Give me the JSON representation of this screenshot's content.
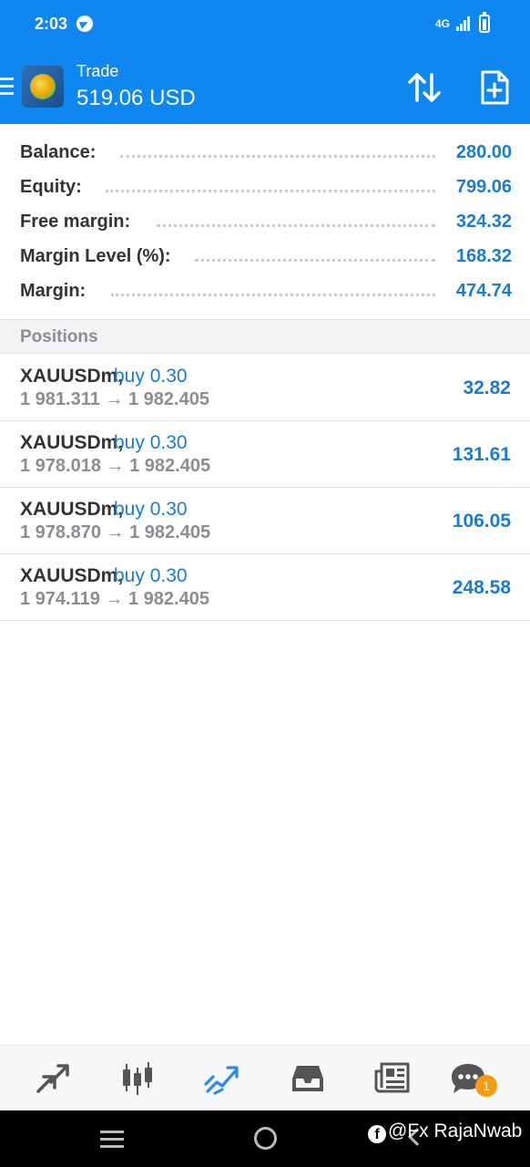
{
  "status_bar": {
    "time": "2:03",
    "network": "4G"
  },
  "header": {
    "title": "Trade",
    "balance_display": "519.06 USD"
  },
  "account": [
    {
      "label": "Balance:",
      "value": "280.00"
    },
    {
      "label": "Equity:",
      "value": "799.06"
    },
    {
      "label": "Free margin:",
      "value": "324.32"
    },
    {
      "label": "Margin Level (%):",
      "value": "168.32"
    },
    {
      "label": "Margin:",
      "value": "474.74"
    }
  ],
  "positions_header": "Positions",
  "positions": [
    {
      "symbol": "XAUUSDm,",
      "side": "buy 0.30",
      "prices": "1 981.311 → 1 982.405",
      "profit": "32.82"
    },
    {
      "symbol": "XAUUSDm,",
      "side": "buy 0.30",
      "prices": "1 978.018 → 1 982.405",
      "profit": "131.61"
    },
    {
      "symbol": "XAUUSDm,",
      "side": "buy 0.30",
      "prices": "1 978.870 → 1 982.405",
      "profit": "106.05"
    },
    {
      "symbol": "XAUUSDm,",
      "side": "buy 0.30",
      "prices": "1 974.119 → 1 982.405",
      "profit": "248.58"
    }
  ],
  "tabs": [
    {
      "icon": "quotes-icon",
      "active": false
    },
    {
      "icon": "chart-icon",
      "active": false
    },
    {
      "icon": "trade-icon",
      "active": true
    },
    {
      "icon": "history-icon",
      "active": false
    },
    {
      "icon": "news-icon",
      "active": false
    },
    {
      "icon": "messages-icon",
      "active": false
    }
  ],
  "messages_badge": "1",
  "watermark": "@Fx RajaNwab",
  "colors": {
    "header_bg": "#0f87f0",
    "value_blue": "#1a7cd0",
    "active_tab": "#2a8ae8",
    "badge": "#f39c12"
  }
}
